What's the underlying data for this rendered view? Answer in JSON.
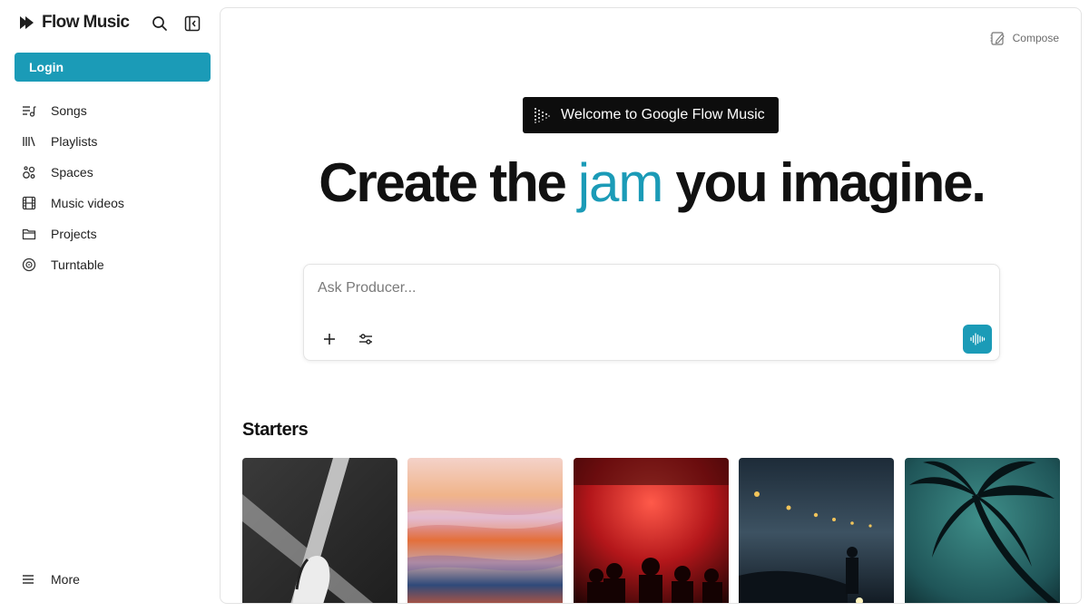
{
  "sidebar": {
    "brand": "Flow Music",
    "login_label": "Login",
    "items": [
      {
        "label": "Songs",
        "icon": "songs-icon"
      },
      {
        "label": "Playlists",
        "icon": "playlists-icon"
      },
      {
        "label": "Spaces",
        "icon": "spaces-icon"
      },
      {
        "label": "Music videos",
        "icon": "film-icon"
      },
      {
        "label": "Projects",
        "icon": "folder-icon"
      },
      {
        "label": "Turntable",
        "icon": "disc-icon"
      }
    ],
    "more_label": "More"
  },
  "main": {
    "compose_label": "Compose",
    "welcome_label": "Welcome to Google Flow Music",
    "headline": {
      "before": "Create the",
      "accent": "jam",
      "after": "you imagine."
    },
    "prompt": {
      "placeholder": "Ask Producer..."
    },
    "starters_title": "Starters",
    "starters": [
      {
        "name": "starter-card-light-beams"
      },
      {
        "name": "starter-card-pastel-sky"
      },
      {
        "name": "starter-card-red-club"
      },
      {
        "name": "starter-card-foggy-street"
      },
      {
        "name": "starter-card-palm-tree"
      }
    ]
  },
  "colors": {
    "accent": "#1b9bb7",
    "dark": "#0d0d0d"
  }
}
